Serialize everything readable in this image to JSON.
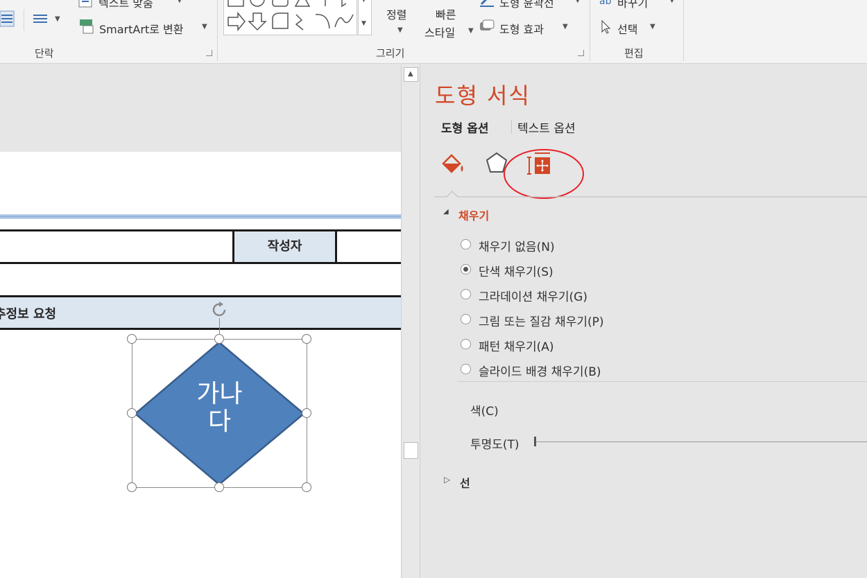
{
  "ribbon": {
    "groups": {
      "paragraph": "단락",
      "drawing": "그리기",
      "editing": "편집"
    },
    "text_align": "텍스트 맞춤",
    "smartart_convert": "SmartArt로 변환",
    "arrange": "정렬",
    "quick_styles_1": "빠른",
    "quick_styles_2": "스타일",
    "shape_outline": "도형 윤곽선",
    "shape_effects": "도형 효과",
    "replace": "바꾸기",
    "select": "선택"
  },
  "document": {
    "author_header": "작성자",
    "section_title": "추정보 요청",
    "shape_text_line1": "가나",
    "shape_text_line2": "다",
    "shape_color": "#4f81bd"
  },
  "pane": {
    "title": "도형 서식",
    "tabs": [
      "도형 옵션",
      "텍스트 옵션"
    ],
    "fill_section": "채우기",
    "fill_options": [
      {
        "label": "채우기 없음(N)",
        "selected": false
      },
      {
        "label": "단색 채우기(S)",
        "selected": true
      },
      {
        "label": "그라데이션 채우기(G)",
        "selected": false
      },
      {
        "label": "그림 또는 질감 채우기(P)",
        "selected": false
      },
      {
        "label": "패턴 채우기(A)",
        "selected": false
      },
      {
        "label": "슬라이드 배경 채우기(B)",
        "selected": false
      }
    ],
    "color_label": "색(C)",
    "transparency_label": "투명도(T)",
    "line_section": "선",
    "accent": "#d24726",
    "highlight_circle": "#e8202a"
  }
}
